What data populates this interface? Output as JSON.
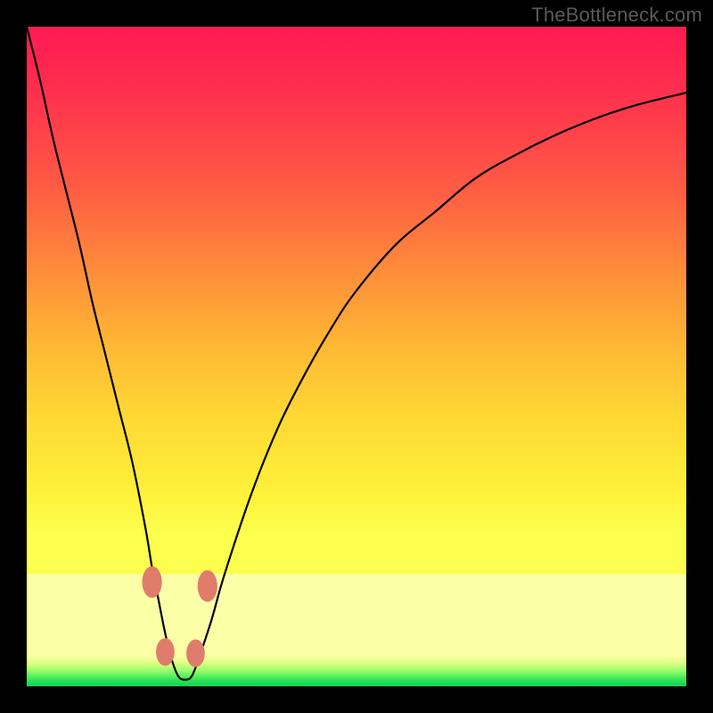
{
  "watermark": "TheBottleneck.com",
  "chart_data": {
    "type": "line",
    "title": "",
    "xlabel": "",
    "ylabel": "",
    "xlim": [
      0,
      100
    ],
    "ylim": [
      0,
      100
    ],
    "grid": false,
    "legend": false,
    "annotations": [],
    "background_gradient_stops": [
      {
        "pct": 0,
        "color": "#ff1a52"
      },
      {
        "pct": 25,
        "color": "#ff5a44"
      },
      {
        "pct": 50,
        "color": "#ffb634"
      },
      {
        "pct": 74,
        "color": "#fff23a"
      },
      {
        "pct": 83,
        "color": "#fbffa6"
      },
      {
        "pct": 95,
        "color": "#fbffa6"
      },
      {
        "pct": 100,
        "color": "#18d956"
      }
    ],
    "series": [
      {
        "name": "bottleneck-curve",
        "x": [
          0,
          2,
          4,
          6,
          8,
          10,
          12,
          14,
          16,
          18,
          19,
          20,
          21,
          22,
          23,
          24,
          25,
          26,
          28,
          30,
          34,
          38,
          42,
          46,
          50,
          56,
          62,
          68,
          74,
          80,
          86,
          92,
          100
        ],
        "y": [
          100,
          92,
          83,
          75,
          67,
          58,
          50,
          42,
          34,
          24,
          18,
          13,
          8,
          4,
          1.5,
          1,
          1.5,
          4,
          10,
          17,
          29,
          39,
          47,
          54,
          60,
          67,
          72,
          77,
          80.5,
          83.5,
          86,
          88,
          90
        ]
      }
    ],
    "markers": [
      {
        "name": "bead-left-upper",
        "x": 19.0,
        "y": 15.8,
        "rx": 1.5,
        "ry": 2.4
      },
      {
        "name": "bead-left-lower",
        "x": 21.0,
        "y": 5.2,
        "rx": 1.4,
        "ry": 2.1
      },
      {
        "name": "bead-right-lower",
        "x": 25.6,
        "y": 5.0,
        "rx": 1.4,
        "ry": 2.1
      },
      {
        "name": "bead-right-upper",
        "x": 27.4,
        "y": 15.2,
        "rx": 1.5,
        "ry": 2.4
      }
    ]
  }
}
